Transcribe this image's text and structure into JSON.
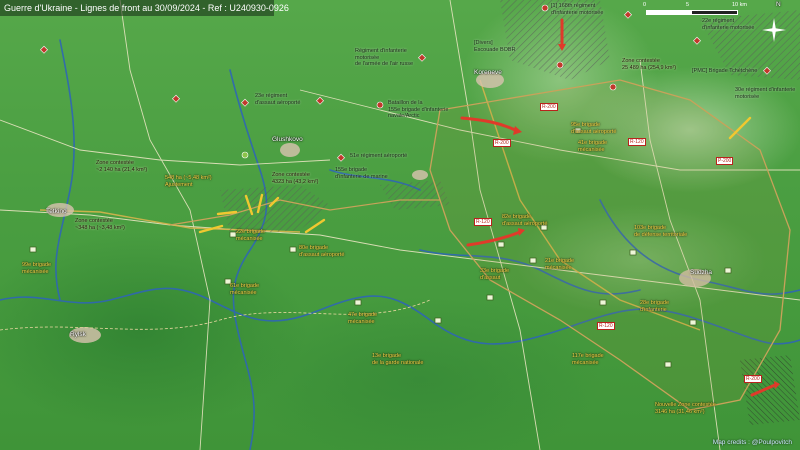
{
  "title": "Guerre d'Ukraine - Lignes de front au 30/09/2024 - Ref : U240930-0926",
  "credits": "Map credits : @Poulpovitch",
  "scale": {
    "labels": [
      "0",
      "5",
      "10 km"
    ]
  },
  "compass": {
    "label": "N"
  },
  "colors": {
    "ukraine_units": "#f4d84a",
    "russian_units": "#c0392b",
    "front_line": "#c8a25a",
    "arrow_ru": "#e03a2a"
  },
  "cities": [
    {
      "name": "Koreneve"
    },
    {
      "name": "Glushkovo"
    },
    {
      "name": "Tetkino"
    },
    {
      "name": "Sudzha"
    },
    {
      "name": "Rylsk"
    }
  ],
  "ru_labels": [
    {
      "text": "[1] 168th régiment\nd'infanterie motorisée"
    },
    {
      "text": "[Divers]\nEscouade BOBR"
    },
    {
      "text": "Régiment d'infanterie\nmotorisée\nde l'armée de l'air russe"
    },
    {
      "text": "23e régiment\nd'assaut aéroporté"
    },
    {
      "text": "Bataillon de la\n155e brigade d'infanterie\nnavale/Arctic"
    },
    {
      "text": "51e régiment aéroporté"
    },
    {
      "text": "155e brigade\nd'infanterie de marine"
    },
    {
      "text": "22e régiment\nd'infanterie motorisée"
    },
    {
      "text": "30e régiment d'infanterie\nmotorisée"
    },
    {
      "text": "[PMC] Brigade Tchétchène"
    }
  ],
  "ua_labels": [
    {
      "text": "95e brigade\nd'assaut aéroporté"
    },
    {
      "text": "82e brigade\nd'assaut aéroporté"
    },
    {
      "text": "22e brigade\nmécanisée"
    },
    {
      "text": "80e brigade\nd'assaut aéroporté"
    },
    {
      "text": "61e brigade\nmécanisée"
    },
    {
      "text": "47e brigade\nmécanisée"
    },
    {
      "text": "33e brigade\nd'assaut"
    },
    {
      "text": "21e brigade\nmécanisée"
    },
    {
      "text": "41e brigade\nmécanisée"
    },
    {
      "text": "103e brigade\nde défense territoriale"
    },
    {
      "text": "28e brigade\nd'infanterie"
    },
    {
      "text": "117e brigade\nmécanisée"
    },
    {
      "text": "99e brigade\nmécanisée"
    },
    {
      "text": "13e brigade\nde la garde nationale"
    }
  ],
  "zones": [
    {
      "text": "Zone contestée\n4323 ha (43,2 km²)"
    },
    {
      "text": "548 ha (~5,48 km²)\nAjustement"
    },
    {
      "text": "Zone contestée\n~348 ha (~3,48 km²)"
    },
    {
      "text": "Zone contestée\n25 489 ha (254,9 km²)"
    },
    {
      "text": "Nouvelle Zone contestée\n3146 ha (31,46 km²)"
    },
    {
      "text": "Zone contestée\n~2 140 ha (21,4 km²)"
    }
  ],
  "roads": [
    "R-200",
    "R-200",
    "P-200",
    "R-120",
    "R-120",
    "R-120",
    "R-200"
  ]
}
